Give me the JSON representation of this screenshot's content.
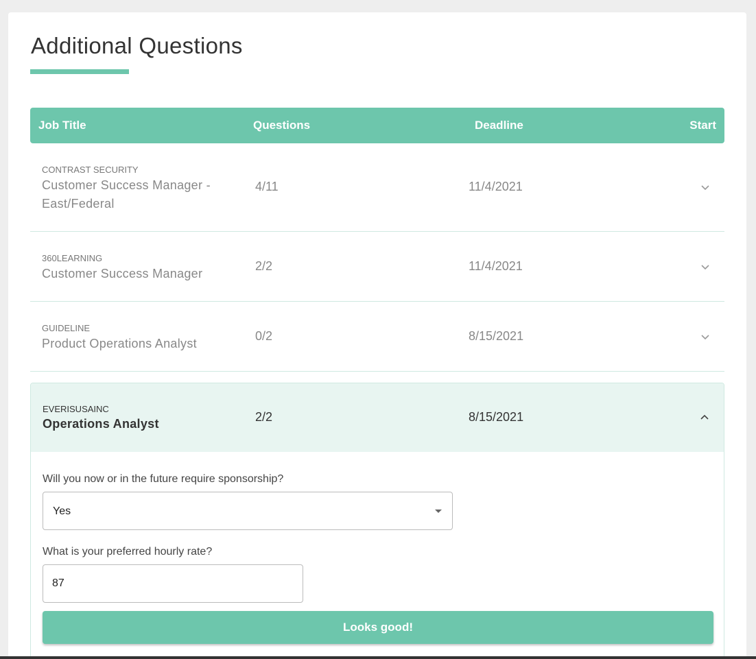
{
  "page": {
    "title": "Additional Questions",
    "accent_color": "#6dc6ac"
  },
  "table": {
    "headers": {
      "job_title": "Job Title",
      "questions": "Questions",
      "deadline": "Deadline",
      "start": "Start"
    },
    "rows": [
      {
        "company": "CONTRAST SECURITY",
        "job": "Customer Success Manager - East/Federal",
        "questions": "4/11",
        "deadline": "11/4/2021",
        "icon": "chevron-down-icon"
      },
      {
        "company": "360LEARNING",
        "job": "Customer Success Manager",
        "questions": "2/2",
        "deadline": "11/4/2021",
        "icon": "chevron-down-icon"
      },
      {
        "company": "GUIDELINE",
        "job": "Product Operations Analyst",
        "questions": "0/2",
        "deadline": "8/15/2021",
        "icon": "chevron-down-icon"
      },
      {
        "company": "EVERISUSAINC",
        "job": "Operations Analyst",
        "questions": "2/2",
        "deadline": "8/15/2021",
        "icon": "chevron-up-icon",
        "expanded": true
      }
    ]
  },
  "form": {
    "q1_label": "Will you now or in the future require sponsorship?",
    "q1_value": "Yes",
    "q2_label": "What is your preferred hourly rate?",
    "q2_value": "87",
    "submit_label": "Looks good!"
  }
}
